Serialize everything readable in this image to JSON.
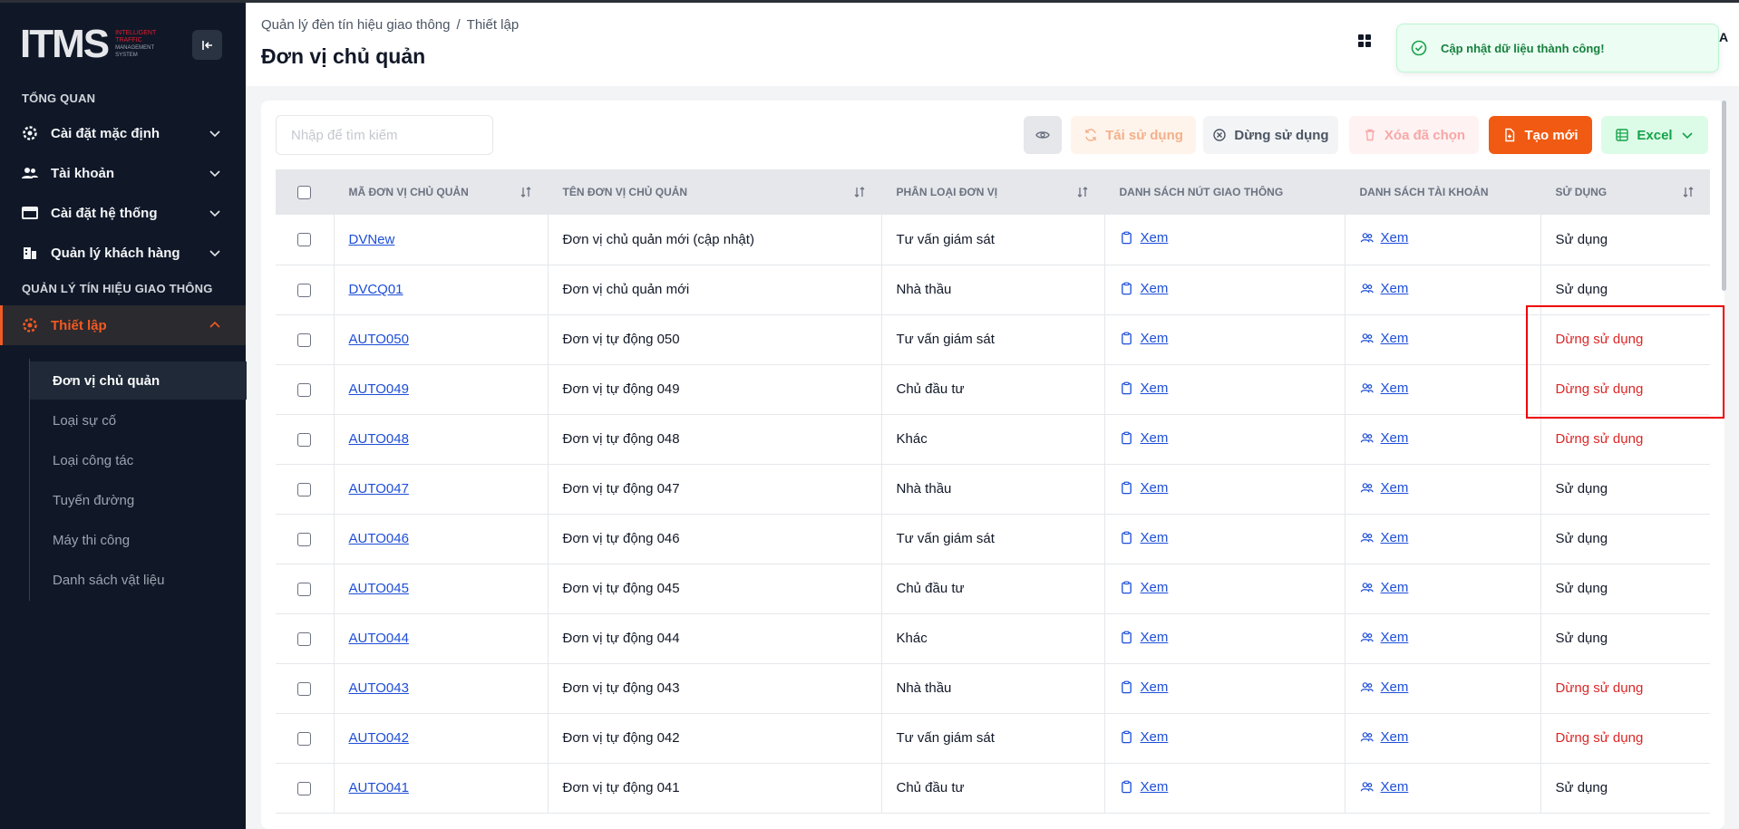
{
  "app": {
    "logo_text": "ITMS",
    "logo_sub": [
      "INTELLIGENT",
      "TRAFFIC",
      "MANAGEMENT SYSTEM"
    ]
  },
  "sidebar": {
    "sections": [
      "TỔNG QUAN",
      "QUẢN LÝ TÍN HIỆU GIAO THÔNG"
    ],
    "items": [
      {
        "label": "Cài đặt mặc định",
        "icon": "gear-icon"
      },
      {
        "label": "Tài khoản",
        "icon": "users-icon"
      },
      {
        "label": "Cài đặt hệ thống",
        "icon": "window-icon"
      },
      {
        "label": "Quản lý khách hàng",
        "icon": "building-icon"
      },
      {
        "label": "Thiết lập",
        "icon": "gear-icon"
      }
    ],
    "subitems": [
      "Đơn vị chủ quản",
      "Loại sự cố",
      "Loại công tác",
      "Tuyến đường",
      "Máy thi công",
      "Danh sách vật liệu"
    ]
  },
  "header": {
    "breadcrumb": [
      "Quản lý đèn tín hiệu giao thông",
      "Thiết lập"
    ],
    "title": "Đơn vị chủ quản",
    "letter": "A"
  },
  "toast": {
    "message": "Cập nhật dữ liệu thành công!"
  },
  "toolbar": {
    "search_placeholder": "Nhập để tìm kiếm",
    "reuse": "Tái sử dụng",
    "stop": "Dừng sử dụng",
    "delete": "Xóa đã chọn",
    "create": "Tạo mới",
    "excel": "Excel"
  },
  "table": {
    "headers": [
      "MÃ ĐƠN VỊ CHỦ QUẢN",
      "TÊN ĐƠN VỊ CHỦ QUẢN",
      "PHÂN LOẠI ĐƠN VỊ",
      "DANH SÁCH NÚT GIAO THÔNG",
      "DANH SÁCH TÀI KHOẢN",
      "SỬ DỤNG"
    ],
    "view_label": "Xem",
    "rows": [
      {
        "code": "DVNew",
        "name": "Đơn vị chủ quản mới (cập nhật)",
        "type": "Tư vấn giám sát",
        "status": "Sử dụng",
        "active": true
      },
      {
        "code": "DVCQ01",
        "name": "Đơn vị chủ quản mới",
        "type": "Nhà thầu",
        "status": "Sử dụng",
        "active": true
      },
      {
        "code": "AUTO050",
        "name": "Đơn vị tự động 050",
        "type": "Tư vấn giám sát",
        "status": "Dừng sử dụng",
        "active": false
      },
      {
        "code": "AUTO049",
        "name": "Đơn vị tự động 049",
        "type": "Chủ đầu tư",
        "status": "Dừng sử dụng",
        "active": false
      },
      {
        "code": "AUTO048",
        "name": "Đơn vị tự động 048",
        "type": "Khác",
        "status": "Dừng sử dụng",
        "active": false
      },
      {
        "code": "AUTO047",
        "name": "Đơn vị tự động 047",
        "type": "Nhà thầu",
        "status": "Sử dụng",
        "active": true
      },
      {
        "code": "AUTO046",
        "name": "Đơn vị tự động 046",
        "type": "Tư vấn giám sát",
        "status": "Sử dụng",
        "active": true
      },
      {
        "code": "AUTO045",
        "name": "Đơn vị tự động 045",
        "type": "Chủ đầu tư",
        "status": "Sử dụng",
        "active": true
      },
      {
        "code": "AUTO044",
        "name": "Đơn vị tự động 044",
        "type": "Khác",
        "status": "Sử dụng",
        "active": true
      },
      {
        "code": "AUTO043",
        "name": "Đơn vị tự động 043",
        "type": "Nhà thầu",
        "status": "Dừng sử dụng",
        "active": false
      },
      {
        "code": "AUTO042",
        "name": "Đơn vị tự động 042",
        "type": "Tư vấn giám sát",
        "status": "Dừng sử dụng",
        "active": false
      },
      {
        "code": "AUTO041",
        "name": "Đơn vị tự động 041",
        "type": "Chủ đầu tư",
        "status": "Sử dụng",
        "active": true
      }
    ]
  },
  "colors": {
    "accent": "#f05a12",
    "sidebar_bg": "#101828",
    "link": "#1d4ed8",
    "inactive": "#dc2626",
    "success": "#15803d"
  }
}
